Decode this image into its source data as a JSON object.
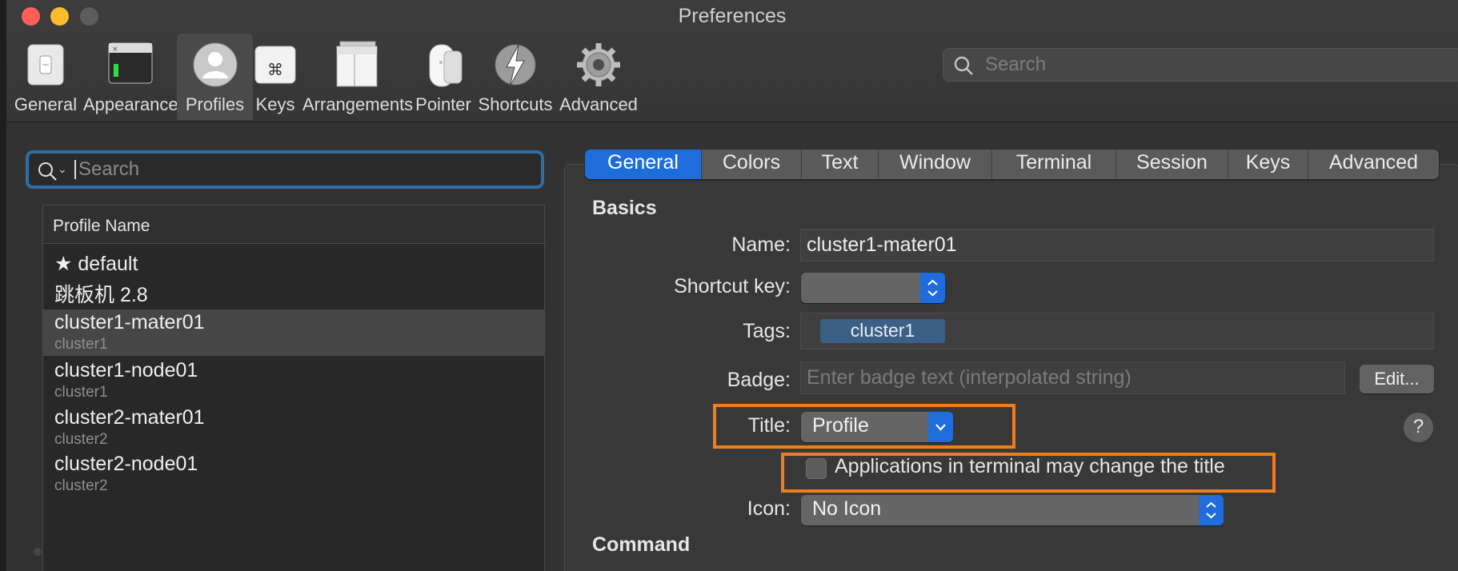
{
  "window": {
    "title": "Preferences"
  },
  "toolbar": {
    "items": [
      {
        "label": "General",
        "icon": "general-switch-icon"
      },
      {
        "label": "Appearance",
        "icon": "appearance-terminal-icon"
      },
      {
        "label": "Profiles",
        "icon": "profiles-person-icon",
        "active": true
      },
      {
        "label": "Keys",
        "icon": "keys-command-icon"
      },
      {
        "label": "Arrangements",
        "icon": "arrangements-window-icon"
      },
      {
        "label": "Pointer",
        "icon": "pointer-mouse-icon"
      },
      {
        "label": "Shortcuts",
        "icon": "shortcuts-lightning-icon"
      },
      {
        "label": "Advanced",
        "icon": "advanced-gear-icon"
      }
    ],
    "search_placeholder": "Search"
  },
  "profiles": {
    "search_placeholder": "Search",
    "column_header": "Profile Name",
    "rows": [
      {
        "name": "★ default",
        "tag": ""
      },
      {
        "name": "跳板机 2.8",
        "tag": ""
      },
      {
        "name": "cluster1-mater01",
        "tag": "cluster1",
        "selected": true
      },
      {
        "name": "cluster1-node01",
        "tag": "cluster1"
      },
      {
        "name": "cluster2-mater01",
        "tag": "cluster2"
      },
      {
        "name": "cluster2-node01",
        "tag": "cluster2"
      }
    ]
  },
  "settings": {
    "tabs": [
      "General",
      "Colors",
      "Text",
      "Window",
      "Terminal",
      "Session",
      "Keys",
      "Advanced"
    ],
    "active_tab": "General",
    "basics_heading": "Basics",
    "name_label": "Name:",
    "name_value": "cluster1-mater01",
    "shortcut_label": "Shortcut key:",
    "shortcut_value": "",
    "tags_label": "Tags:",
    "tag_value": "cluster1",
    "badge_label": "Badge:",
    "badge_placeholder": "Enter badge text (interpolated string)",
    "edit_button": "Edit...",
    "title_label": "Title:",
    "title_value": "Profile",
    "help_label": "?",
    "apps_change_title_label": "Applications in terminal may change the title",
    "apps_change_title_checked": false,
    "icon_label": "Icon:",
    "icon_value": "No Icon",
    "command_heading": "Command"
  },
  "colors": {
    "accent": "#1f6ddd",
    "highlight": "#f07d1a",
    "window_bg": "#323232",
    "tag_chip": "#3c5f85"
  }
}
